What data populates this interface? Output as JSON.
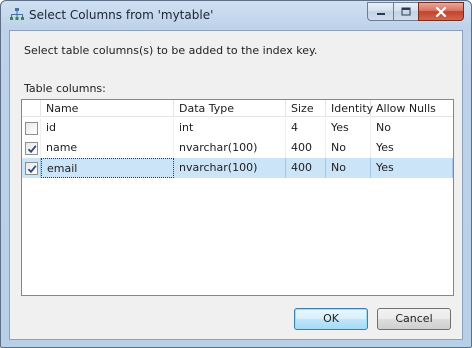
{
  "window": {
    "title": "Select Columns from 'mytable'",
    "icons": {
      "app": "index-icon",
      "minimize": "minimize-icon",
      "maximize": "maximize-icon",
      "close": "close-icon"
    }
  },
  "dialog": {
    "instruction": "Select table columns(s) to be added to the index key.",
    "table_label": "Table columns:",
    "headers": [
      "Name",
      "Data Type",
      "Size",
      "Identity",
      "Allow Nulls"
    ],
    "rows": [
      {
        "checked": false,
        "name": "id",
        "data_type": "int",
        "size": "4",
        "identity": "Yes",
        "allow_nulls": "No",
        "selected": false
      },
      {
        "checked": true,
        "name": "name",
        "data_type": "nvarchar(100)",
        "size": "400",
        "identity": "No",
        "allow_nulls": "Yes",
        "selected": false
      },
      {
        "checked": true,
        "name": "email",
        "data_type": "nvarchar(100)",
        "size": "400",
        "identity": "No",
        "allow_nulls": "Yes",
        "selected": true
      }
    ],
    "buttons": {
      "ok": "OK",
      "cancel": "Cancel"
    }
  },
  "colors": {
    "selection": "#cce4f7",
    "close_button": "#c2432b",
    "client_background": "#f0f0f0"
  }
}
